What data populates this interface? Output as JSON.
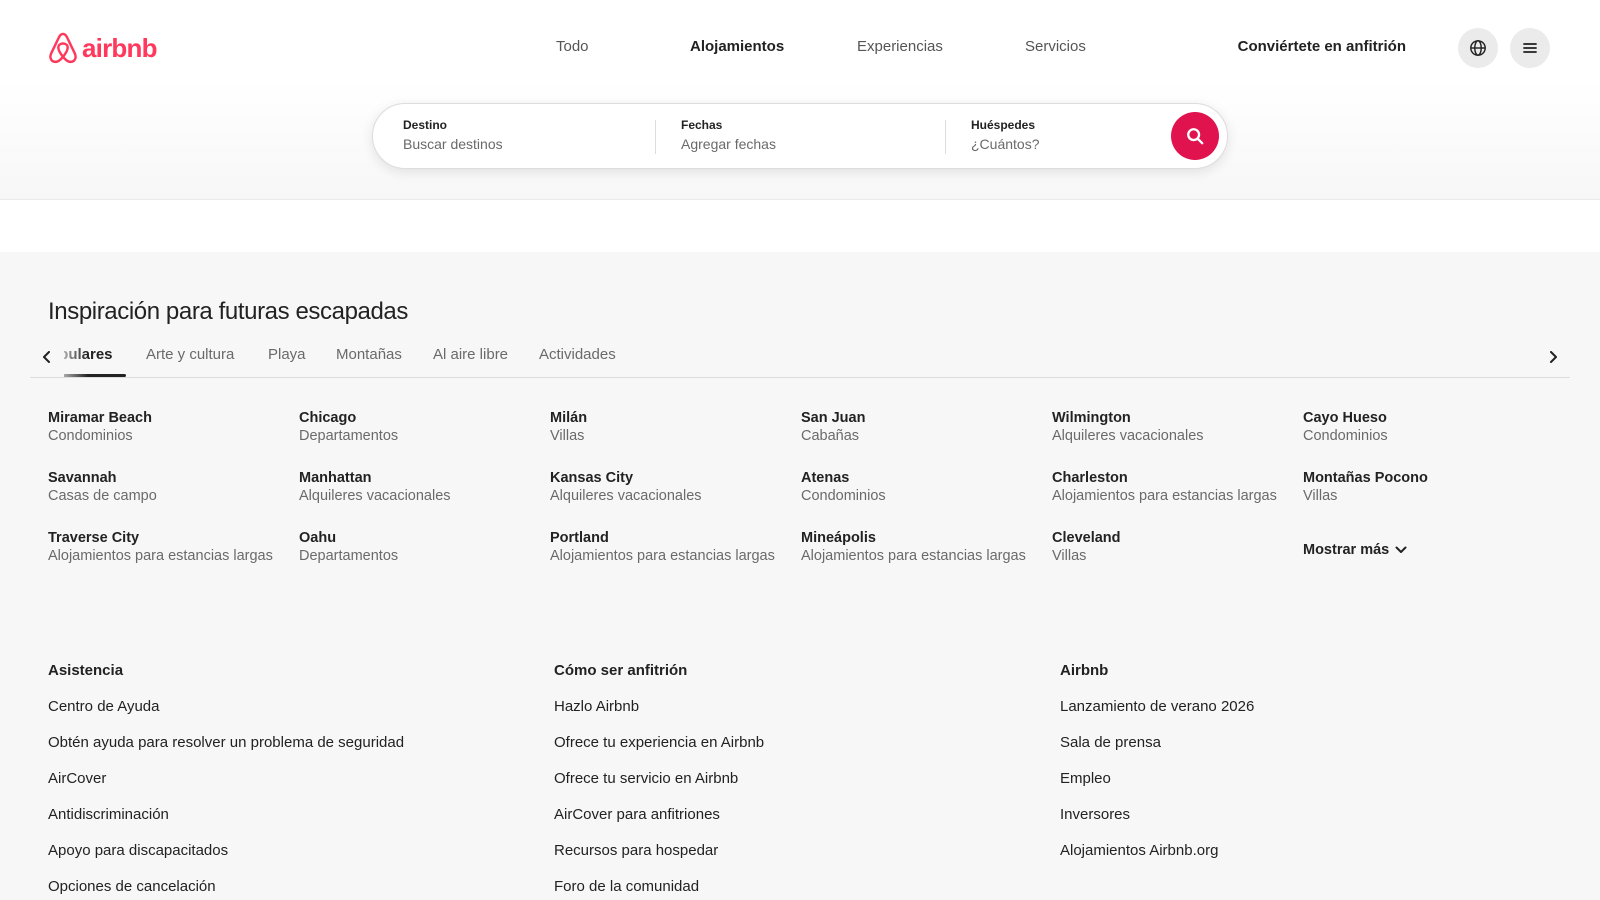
{
  "header": {
    "logo_text": "airbnb",
    "nav": [
      {
        "label": "Todo",
        "active": false
      },
      {
        "label": "Alojamientos",
        "active": true
      },
      {
        "label": "Experiencias",
        "active": false
      },
      {
        "label": "Servicios",
        "active": false
      }
    ],
    "host_link": "Conviértete en anfitrión",
    "icons": {
      "language": "globe-icon",
      "menu": "hamburger-menu-icon",
      "logo": "airbnb-logo-icon"
    }
  },
  "search": {
    "destination": {
      "label": "Destino",
      "placeholder": "Buscar destinos"
    },
    "dates": {
      "label": "Fechas",
      "placeholder": "Agregar fechas"
    },
    "guests": {
      "label": "Huéspedes",
      "placeholder": "¿Cuántos?"
    },
    "button_icon": "search-icon"
  },
  "inspiration": {
    "title": "Inspiración para futuras escapadas",
    "tabs": [
      {
        "label": "Populares",
        "active": true
      },
      {
        "label": "Arte y cultura",
        "active": false
      },
      {
        "label": "Playa",
        "active": false
      },
      {
        "label": "Montañas",
        "active": false
      },
      {
        "label": "Al aire libre",
        "active": false
      },
      {
        "label": "Actividades",
        "active": false
      }
    ],
    "destinations": [
      {
        "city": "Miramar Beach",
        "type": "Condominios"
      },
      {
        "city": "Chicago",
        "type": "Departamentos"
      },
      {
        "city": "Milán",
        "type": "Villas"
      },
      {
        "city": "San Juan",
        "type": "Cabañas"
      },
      {
        "city": "Wilmington",
        "type": "Alquileres vacacionales"
      },
      {
        "city": "Cayo Hueso",
        "type": "Condominios"
      },
      {
        "city": "Savannah",
        "type": "Casas de campo"
      },
      {
        "city": "Manhattan",
        "type": "Alquileres vacacionales"
      },
      {
        "city": "Kansas City",
        "type": "Alquileres vacacionales"
      },
      {
        "city": "Atenas",
        "type": "Condominios"
      },
      {
        "city": "Charleston",
        "type": "Alojamientos para estancias largas"
      },
      {
        "city": "Montañas Pocono",
        "type": "Villas"
      },
      {
        "city": "Traverse City",
        "type": "Alojamientos para estancias largas"
      },
      {
        "city": "Oahu",
        "type": "Departamentos"
      },
      {
        "city": "Portland",
        "type": "Alojamientos para estancias largas"
      },
      {
        "city": "Mineápolis",
        "type": "Alojamientos para estancias largas"
      },
      {
        "city": "Cleveland",
        "type": "Villas"
      }
    ],
    "show_more": "Mostrar más"
  },
  "footer": {
    "columns": [
      {
        "heading": "Asistencia",
        "links": [
          "Centro de Ayuda",
          "Obtén ayuda para resolver un problema de seguridad",
          "AirCover",
          "Antidiscriminación",
          "Apoyo para discapacitados",
          "Opciones de cancelación"
        ]
      },
      {
        "heading": "Cómo ser anfitrión",
        "links": [
          "Hazlo Airbnb",
          "Ofrece tu experiencia en Airbnb",
          "Ofrece tu servicio en Airbnb",
          "AirCover para anfitriones",
          "Recursos para hospedar",
          "Foro de la comunidad"
        ]
      },
      {
        "heading": "Airbnb",
        "links": [
          "Lanzamiento de verano 2026",
          "Sala de prensa",
          "Empleo",
          "Inversores",
          "Alojamientos Airbnb.org"
        ]
      }
    ]
  },
  "colors": {
    "brand": "#e0134f",
    "logo": "#ff385c",
    "text": "#222222",
    "muted": "#6a6a6a"
  }
}
